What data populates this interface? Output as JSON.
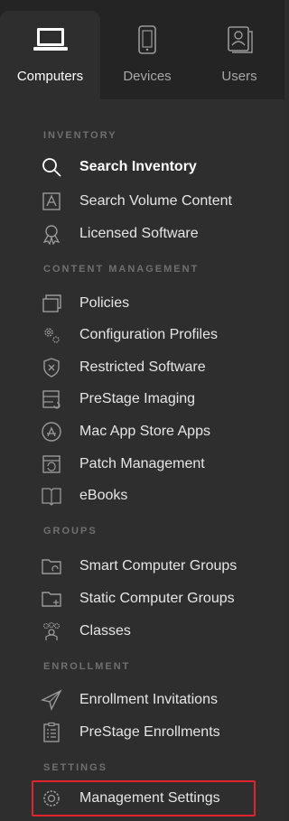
{
  "tabs": [
    {
      "label": "Computers",
      "icon": "laptop-icon",
      "active": true
    },
    {
      "label": "Devices",
      "icon": "mobile-device-icon",
      "active": false
    },
    {
      "label": "Users",
      "icon": "user-contact-icon",
      "active": false
    }
  ],
  "sections": {
    "inventory": "INVENTORY",
    "content_management": "CONTENT MANAGEMENT",
    "groups": "GROUPS",
    "enrollment": "ENROLLMENT",
    "settings": "SETTINGS"
  },
  "items": {
    "search_inventory": "Search Inventory",
    "search_volume_content": "Search Volume Content",
    "licensed_software": "Licensed Software",
    "policies": "Policies",
    "configuration_profiles": "Configuration Profiles",
    "restricted_software": "Restricted Software",
    "prestage_imaging": "PreStage Imaging",
    "mac_app_store_apps": "Mac App Store Apps",
    "patch_management": "Patch Management",
    "ebooks": "eBooks",
    "smart_computer_groups": "Smart Computer Groups",
    "static_computer_groups": "Static Computer Groups",
    "classes": "Classes",
    "enrollment_invitations": "Enrollment Invitations",
    "prestage_enrollments": "PreStage Enrollments",
    "management_settings": "Management Settings"
  },
  "colors": {
    "highlight": "#e0242e",
    "background": "#2e2e2e",
    "section_header": "#6f6f6f"
  }
}
